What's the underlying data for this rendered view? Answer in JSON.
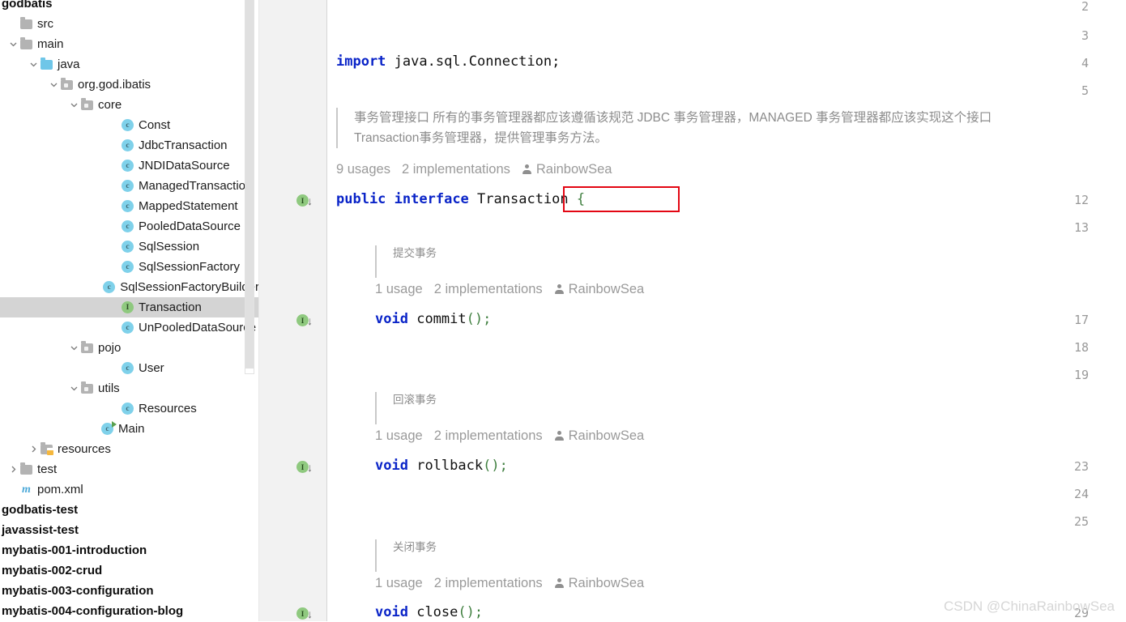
{
  "sidebar": {
    "partial_top_label": "godbatis",
    "tree": [
      {
        "label": "src",
        "depth": 0,
        "icon": "folder-gray",
        "twisty": "none",
        "selected": false
      },
      {
        "label": "main",
        "depth": 0,
        "icon": "folder-gray",
        "twisty": "expanded",
        "selected": false
      },
      {
        "label": "java",
        "depth": 1,
        "icon": "folder-blue",
        "twisty": "expanded",
        "selected": false
      },
      {
        "label": "org.god.ibatis",
        "depth": 2,
        "icon": "folder-pkg",
        "twisty": "expanded",
        "selected": false
      },
      {
        "label": "core",
        "depth": 3,
        "icon": "folder-pkg",
        "twisty": "expanded",
        "selected": false
      },
      {
        "label": "Const",
        "depth": 5,
        "icon": "class-c",
        "twisty": "none",
        "selected": false
      },
      {
        "label": "JdbcTransaction",
        "depth": 5,
        "icon": "class-c",
        "twisty": "none",
        "selected": false
      },
      {
        "label": "JNDIDataSource",
        "depth": 5,
        "icon": "class-c",
        "twisty": "none",
        "selected": false
      },
      {
        "label": "ManagedTransaction",
        "depth": 5,
        "icon": "class-c",
        "twisty": "none",
        "selected": false
      },
      {
        "label": "MappedStatement",
        "depth": 5,
        "icon": "class-c",
        "twisty": "none",
        "selected": false
      },
      {
        "label": "PooledDataSource",
        "depth": 5,
        "icon": "class-c",
        "twisty": "none",
        "selected": false
      },
      {
        "label": "SqlSession",
        "depth": 5,
        "icon": "class-c",
        "twisty": "none",
        "selected": false
      },
      {
        "label": "SqlSessionFactory",
        "depth": 5,
        "icon": "class-c",
        "twisty": "none",
        "selected": false
      },
      {
        "label": "SqlSessionFactoryBuilder",
        "depth": 5,
        "icon": "class-c",
        "twisty": "none",
        "selected": false
      },
      {
        "label": "Transaction",
        "depth": 5,
        "icon": "class-i",
        "twisty": "none",
        "selected": true
      },
      {
        "label": "UnPooledDataSource",
        "depth": 5,
        "icon": "class-c",
        "twisty": "none",
        "selected": false
      },
      {
        "label": "pojo",
        "depth": 3,
        "icon": "folder-pkg",
        "twisty": "expanded",
        "selected": false
      },
      {
        "label": "User",
        "depth": 5,
        "icon": "class-c",
        "twisty": "none",
        "selected": false
      },
      {
        "label": "utils",
        "depth": 3,
        "icon": "folder-pkg",
        "twisty": "expanded",
        "selected": false
      },
      {
        "label": "Resources",
        "depth": 5,
        "icon": "class-c",
        "twisty": "none",
        "selected": false
      },
      {
        "label": "Main",
        "depth": 4,
        "icon": "class-main",
        "twisty": "none",
        "selected": false
      },
      {
        "label": "resources",
        "depth": 1,
        "icon": "folder-res",
        "twisty": "collapsed",
        "selected": false
      },
      {
        "label": "test",
        "depth": 0,
        "icon": "folder-gray",
        "twisty": "collapsed",
        "selected": false
      },
      {
        "label": "pom.xml",
        "depth": 0,
        "icon": "maven-m",
        "twisty": "none",
        "selected": false
      }
    ],
    "modules": [
      "godbatis-test",
      "javassist-test",
      "mybatis-001-introduction",
      "mybatis-002-crud",
      "mybatis-003-configuration",
      "mybatis-004-configuration-blog"
    ]
  },
  "editor": {
    "line_numbers": [
      "2",
      "3",
      "4",
      "5",
      "12",
      "13",
      "17",
      "18",
      "19",
      "23",
      "24",
      "25",
      "29"
    ],
    "import_statement": {
      "keyword": "import",
      "rest": " java.sql.Connection;"
    },
    "class_doc": "事务管理接口 所有的事务管理器都应该遵循该规范 JDBC 事务管理器，MANAGED 事务管理器都应该实现这个接口\nTransaction事务管理器，提供管理事务方法。",
    "class_hints": {
      "usages": "9 usages",
      "implementations": "2 implementations",
      "author": "RainbowSea"
    },
    "declaration": {
      "modifier": "public",
      "keyword": "interface",
      "name": "Transaction",
      "brace": "{"
    },
    "members": [
      {
        "doc": "提交事务",
        "usages": "1 usage",
        "implementations": "2 implementations",
        "author": "RainbowSea",
        "return_type": "void",
        "name": "commit",
        "signature": "();"
      },
      {
        "doc": "回滚事务",
        "usages": "1 usage",
        "implementations": "2 implementations",
        "author": "RainbowSea",
        "return_type": "void",
        "name": "rollback",
        "signature": "();"
      },
      {
        "doc": "关闭事务",
        "usages": "1 usage",
        "implementations": "2 implementations",
        "author": "RainbowSea",
        "return_type": "void",
        "name": "close",
        "signature": "();"
      }
    ]
  },
  "watermark": "CSDN @ChinaRainbowSea",
  "colors": {
    "keyword": "#0a24c8",
    "hint": "#9a9a9a",
    "doc": "#8c8c8c",
    "annotation_red": "#e30613",
    "selection": "#d4d4d4",
    "gutter_bg": "#f2f2f2"
  }
}
